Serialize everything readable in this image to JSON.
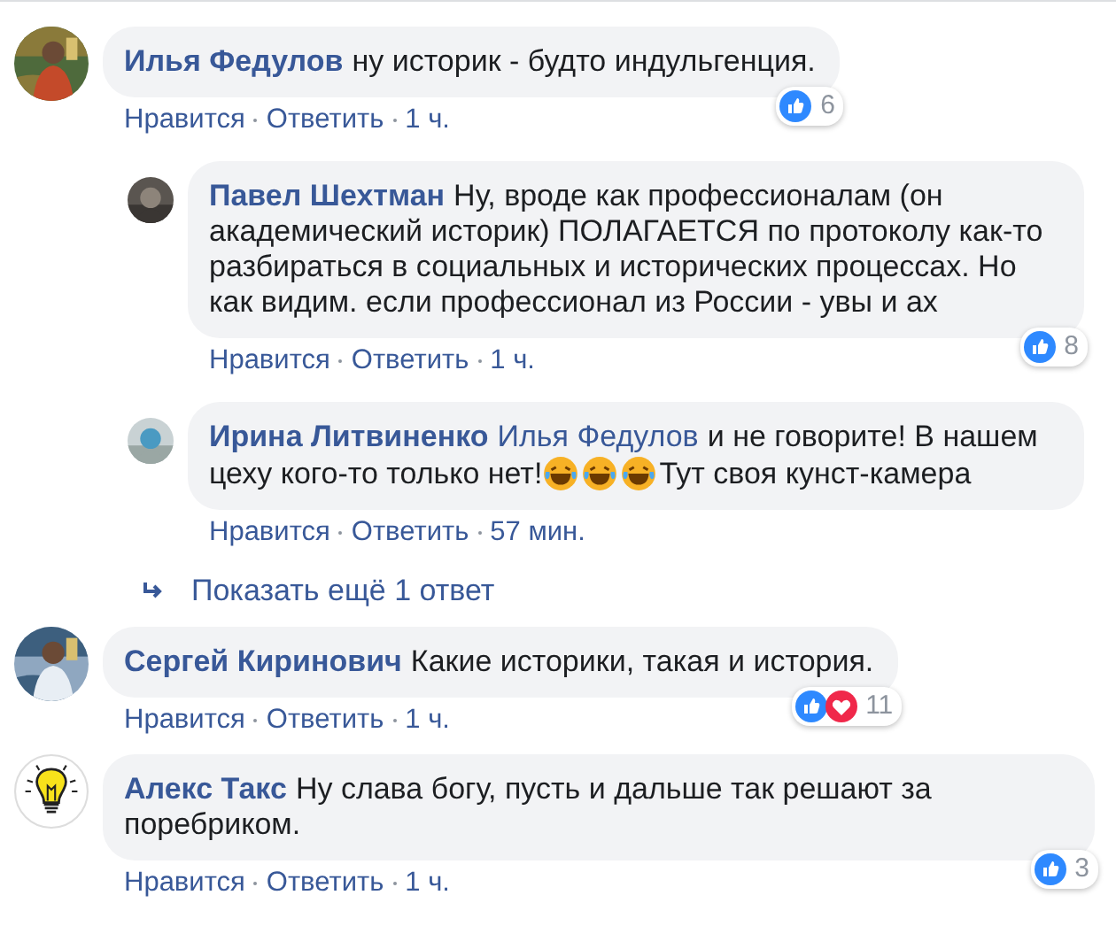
{
  "comments": [
    {
      "author": "Илья Федулов",
      "avatar": {
        "kind": "picture"
      },
      "body": [
        {
          "kind": "text",
          "text": "ну историк - будто индульгенция."
        }
      ],
      "actions": [
        "Нравится",
        "Ответить"
      ],
      "time": "1 ч.",
      "reactions": {
        "icons": [
          {
            "kind": "like"
          }
        ],
        "count": "6"
      },
      "replies": [
        {
          "author": "Павел Шехтман",
          "avatar": {
            "kind": "picture"
          },
          "body": [
            {
              "kind": "text",
              "text": "Ну, вроде как профессионалам (он академический историк) ПОЛАГАЕТСЯ по протоколу как-то разбираться в социальных и исторических процессах. Но как видим. если профессионал из России - увы и ах"
            }
          ],
          "actions": [
            "Нравится",
            "Ответить"
          ],
          "time": "1 ч.",
          "reactions": {
            "icons": [
              {
                "kind": "like"
              }
            ],
            "count": "8"
          }
        },
        {
          "author": "Ирина Литвиненко",
          "avatar": {
            "kind": "picture"
          },
          "body": [
            {
              "kind": "mention",
              "text": "Илья Федулов"
            },
            {
              "kind": "text",
              "text": "и не говорите! В нашем цеху кого-то только нет!"
            },
            {
              "kind": "emoji"
            },
            {
              "kind": "emoji"
            },
            {
              "kind": "emoji"
            },
            {
              "kind": "text",
              "text": "Тут своя кунст-камера"
            }
          ],
          "actions": [
            "Нравится",
            "Ответить"
          ],
          "time": "57 мин."
        }
      ],
      "more_replies": "Показать ещё 1 ответ"
    },
    {
      "author": "Сергей Киринович",
      "avatar": {
        "kind": "picture"
      },
      "body": [
        {
          "kind": "text",
          "text": "Какие историки, такая и история."
        }
      ],
      "actions": [
        "Нравится",
        "Ответить"
      ],
      "time": "1 ч.",
      "reactions": {
        "icons": [
          {
            "kind": "like"
          },
          {
            "kind": "heart"
          }
        ],
        "count": "11"
      }
    },
    {
      "author": "Алекс Такс",
      "avatar": {
        "kind": "bulb"
      },
      "body": [
        {
          "kind": "text",
          "text": "Ну слава богу, пусть и дальше так решают за поребриком."
        }
      ],
      "actions": [
        "Нравится",
        "Ответить"
      ],
      "time": "1 ч.",
      "reactions": {
        "icons": [
          {
            "kind": "like"
          }
        ],
        "count": "3"
      }
    }
  ]
}
